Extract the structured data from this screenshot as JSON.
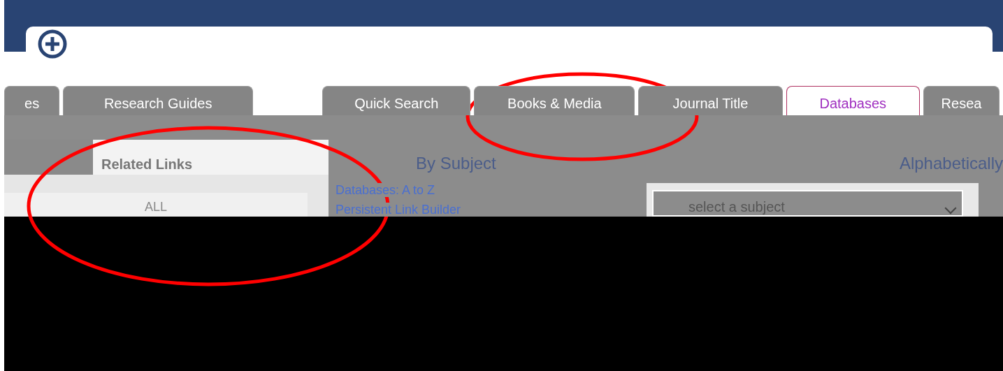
{
  "nav_tabs_left": [
    {
      "label": "es",
      "selected": false
    },
    {
      "label": "Research Guides",
      "selected": false
    }
  ],
  "search_tabs": [
    {
      "label": "Quick Search",
      "selected": false
    },
    {
      "label": "Books & Media",
      "selected": false
    },
    {
      "label": "Journal Title",
      "selected": false
    },
    {
      "label": "Databases",
      "selected": true
    },
    {
      "label": "Resea",
      "selected": false
    }
  ],
  "sidebar": {
    "heading": "Related Links",
    "items": [
      {
        "label": "ALL"
      }
    ]
  },
  "links": [
    "Databases: A to Z",
    "Persistent Link Builder"
  ],
  "browse": {
    "by_subject": "By Subject",
    "alphabetically": "Alphabetically",
    "subject_select": {
      "placeholder": "select a subject"
    }
  }
}
